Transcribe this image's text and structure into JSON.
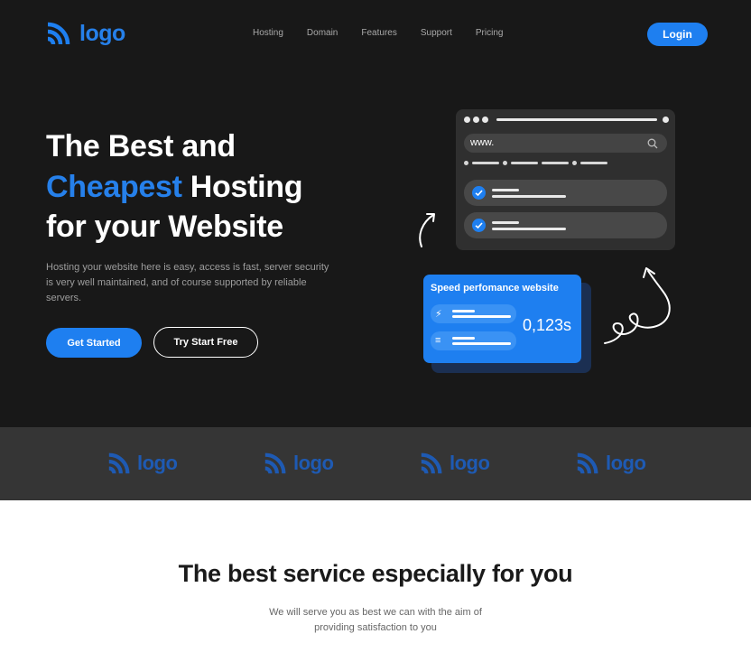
{
  "brand": {
    "logo_text": "logo",
    "accent_color": "#1e7ff0",
    "icon": "signal-arcs-icon"
  },
  "nav": {
    "links": [
      "Hosting",
      "Domain",
      "Features",
      "Support",
      "Pricing"
    ],
    "login_label": "Login"
  },
  "hero": {
    "title_line1": "The Best and",
    "title_accent": "Cheapest",
    "title_line2_rest": " Hosting",
    "title_line3": "for your Website",
    "description": "Hosting your website here is easy, access is fast, server security is very well maintained, and of course supported by reliable servers.",
    "primary_button": "Get Started",
    "secondary_button": "Try Start Free"
  },
  "illustration": {
    "url_text": "www.",
    "speed_title": "Speed perfomance website",
    "speed_value": "0,123s",
    "icons": [
      "check-icon",
      "lightning-icon",
      "fast-forward-icon",
      "search-icon"
    ]
  },
  "partners": {
    "logos": [
      "logo",
      "logo",
      "logo",
      "logo"
    ]
  },
  "services": {
    "title": "The best service especially for you",
    "subtitle": "We will serve you as best we can with the aim of providing satisfaction to you"
  }
}
